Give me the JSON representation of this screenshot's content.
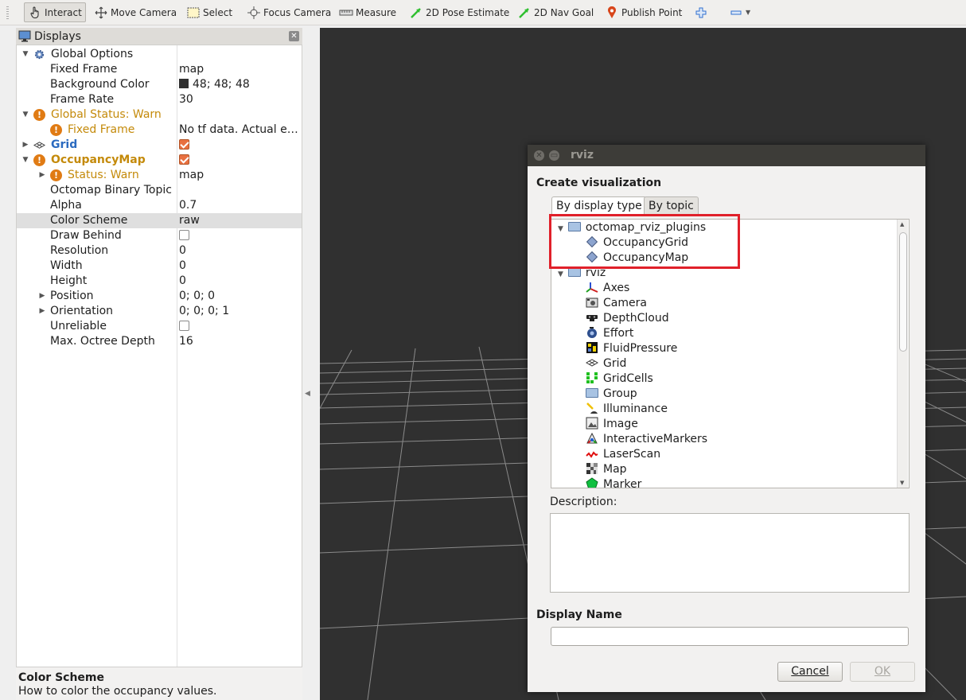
{
  "toolbar": {
    "interact": "Interact",
    "move_camera": "Move Camera",
    "select": "Select",
    "focus_camera": "Focus Camera",
    "measure": "Measure",
    "pose_estimate": "2D Pose Estimate",
    "nav_goal": "2D Nav Goal",
    "publish_point": "Publish Point"
  },
  "displays": {
    "title": "Displays",
    "rows": [
      {
        "name": "Global Options"
      },
      {
        "name": "Fixed Frame",
        "value": "map"
      },
      {
        "name": "Background Color",
        "value": "48; 48; 48"
      },
      {
        "name": "Frame Rate",
        "value": "30"
      },
      {
        "name": "Global Status: Warn"
      },
      {
        "name": "Fixed Frame",
        "value": "No tf data.  Actual e…"
      },
      {
        "name": "Grid"
      },
      {
        "name": "OccupancyMap"
      },
      {
        "name": "Status: Warn",
        "value": "map"
      },
      {
        "name": "Octomap Binary Topic",
        "value": ""
      },
      {
        "name": "Alpha",
        "value": "0.7"
      },
      {
        "name": "Color Scheme",
        "value": "raw"
      },
      {
        "name": "Draw Behind"
      },
      {
        "name": "Resolution",
        "value": "0"
      },
      {
        "name": "Width",
        "value": "0"
      },
      {
        "name": "Height",
        "value": "0"
      },
      {
        "name": "Position",
        "value": "0; 0; 0"
      },
      {
        "name": "Orientation",
        "value": "0; 0; 0; 1"
      },
      {
        "name": "Unreliable"
      },
      {
        "name": "Max. Octree Depth",
        "value": "16"
      }
    ],
    "help_title": "Color Scheme",
    "help_desc": "How to color the occupancy values."
  },
  "dialog": {
    "window_title": "rviz",
    "heading": "Create visualization",
    "tabs": [
      "By display type",
      "By topic"
    ],
    "groups": [
      {
        "name": "octomap_rviz_plugins",
        "items": [
          "OccupancyGrid",
          "OccupancyMap"
        ]
      },
      {
        "name": "rviz",
        "items": [
          "Axes",
          "Camera",
          "DepthCloud",
          "Effort",
          "FluidPressure",
          "Grid",
          "GridCells",
          "Group",
          "Illuminance",
          "Image",
          "InteractiveMarkers",
          "LaserScan",
          "Map",
          "Marker"
        ]
      }
    ],
    "description_label": "Description:",
    "display_name_label": "Display Name",
    "display_name_value": "",
    "cancel": "Cancel",
    "ok": "OK"
  },
  "colors": {
    "viewport_bg": "#303030",
    "warn": "#c48a0a",
    "highlight_box": "#e0202a",
    "grid_blue": "#2c6bc0"
  }
}
